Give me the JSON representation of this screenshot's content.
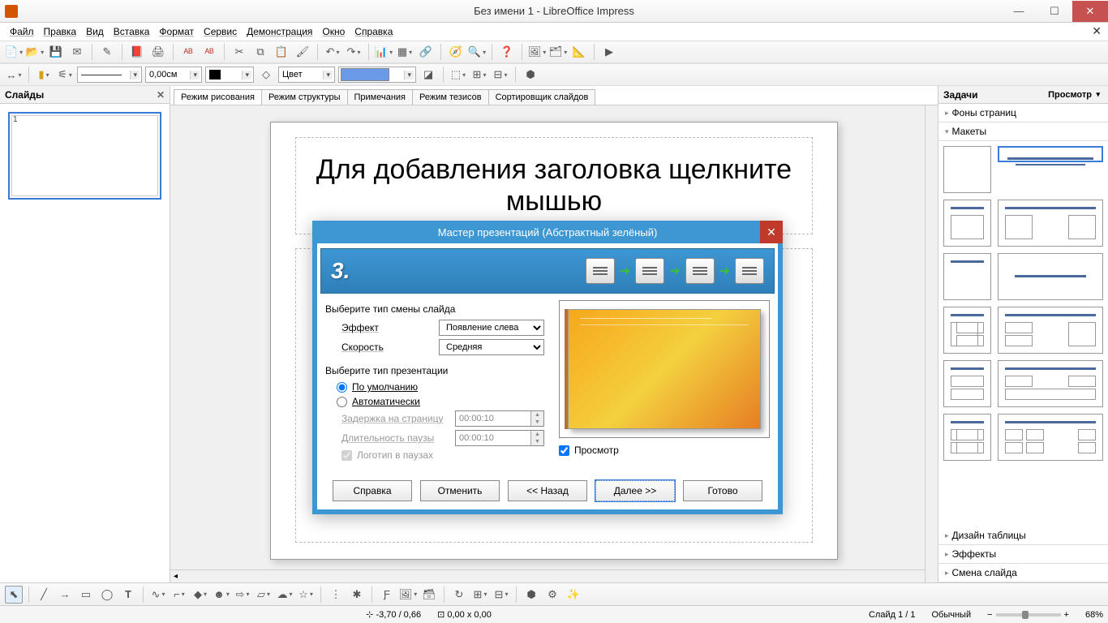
{
  "window": {
    "title": "Без имени 1 - LibreOffice Impress"
  },
  "menu": [
    "Файл",
    "Правка",
    "Вид",
    "Вставка",
    "Формат",
    "Сервис",
    "Демонстрация",
    "Окно",
    "Справка"
  ],
  "toolbar2": {
    "width_value": "0,00см",
    "fill_label": "Цвет"
  },
  "panels": {
    "slides": "Слайды",
    "tasks": "Задачи",
    "tasks_view": "Просмотр",
    "sections": {
      "bg": "Фоны страниц",
      "layouts": "Макеты",
      "table": "Дизайн таблицы",
      "effects": "Эффекты",
      "transition": "Смена слайда"
    }
  },
  "view_tabs": [
    "Режим рисования",
    "Режим структуры",
    "Примечания",
    "Режим тезисов",
    "Сортировщик слайдов"
  ],
  "slide_placeholder": "Для добавления заголовка щелкните мышью",
  "dialog": {
    "title": "Мастер презентаций (Абстрактный зелёный)",
    "step": "3.",
    "group1": "Выберите тип смены слайда",
    "effect_label": "Эффект",
    "effect_value": "Появление слева",
    "speed_label": "Скорость",
    "speed_value": "Средняя",
    "group2": "Выберите тип презентации",
    "radio_default": "По умолчанию",
    "radio_auto": "Автоматически",
    "delay_label": "Задержка на страницу",
    "delay_value": "00:00:10",
    "pause_label": "Длительность паузы",
    "pause_value": "00:00:10",
    "logo_check": "Логотип в паузах",
    "preview_check": "Просмотр",
    "btn_help": "Справка",
    "btn_cancel": "Отменить",
    "btn_back": "<< Назад",
    "btn_next": "Далее >>",
    "btn_finish": "Готово"
  },
  "status": {
    "coords": "-3,70 / 0,66",
    "size": "0,00 x 0,00",
    "slide": "Слайд 1 / 1",
    "mode": "Обычный",
    "zoom": "68%"
  }
}
